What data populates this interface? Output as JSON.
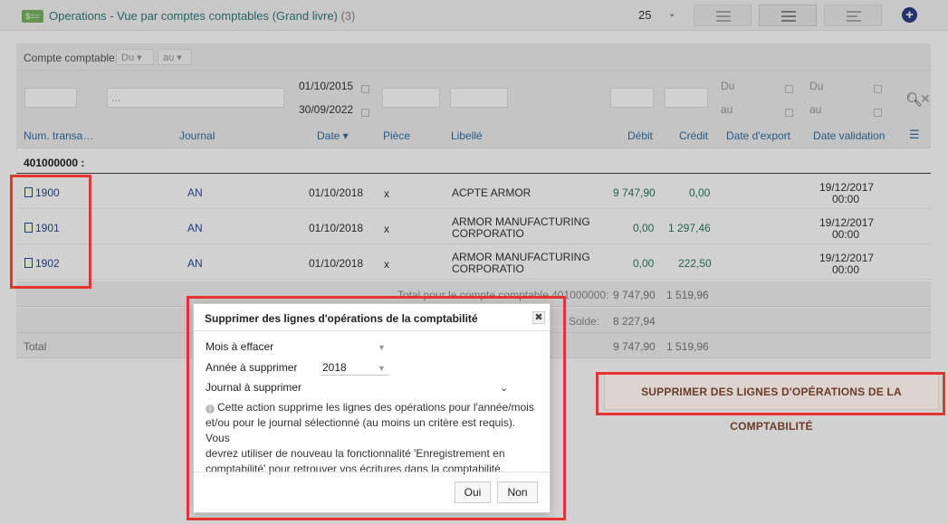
{
  "header": {
    "badge": "$==",
    "title": "Operations - Vue par comptes comptables (Grand livre)",
    "count": "(3)",
    "page_size": "25"
  },
  "filters": {
    "compte_label": "Compte comptable:",
    "du": "Du",
    "au": "au",
    "date_from": "01/10/2015",
    "date_to": "30/09/2022",
    "export_du": "Du",
    "export_au": "au",
    "valid_du": "Du",
    "valid_au": "au",
    "journal_placeholder": "..."
  },
  "columns": {
    "num": "Num. transa…",
    "journal": "Journal",
    "date": "Date ▾",
    "piece": "Pièce",
    "libelle": "Libellé",
    "debit": "Débit",
    "credit": "Crédit",
    "export": "Date d'export",
    "validation": "Date validation"
  },
  "group": {
    "label": "401000000 :"
  },
  "rows": [
    {
      "num": "1900",
      "journal": "AN",
      "date": "01/10/2018",
      "piece": "x",
      "libelle_1": "ACPTE ARMOR",
      "libelle_2": "",
      "debit": "9 747,90",
      "credit": "0,00",
      "validation_date": "19/12/2017",
      "validation_time": "00:00"
    },
    {
      "num": "1901",
      "journal": "AN",
      "date": "01/10/2018",
      "piece": "x",
      "libelle_1": "ARMOR MANUFACTURING",
      "libelle_2": "CORPORATIO",
      "debit": "0,00",
      "credit": "1 297,46",
      "validation_date": "19/12/2017",
      "validation_time": "00:00"
    },
    {
      "num": "1902",
      "journal": "AN",
      "date": "01/10/2018",
      "piece": "x",
      "libelle_1": "ARMOR MANUFACTURING",
      "libelle_2": "CORPORATIO",
      "debit": "0,00",
      "credit": "222,50",
      "validation_date": "19/12/2017",
      "validation_time": "00:00"
    }
  ],
  "totals": {
    "account_label": "Total pour le compte comptable 401000000:",
    "account_debit": "9 747,90",
    "account_credit": "1 519,96",
    "solde_label": "Solde:",
    "solde_value": "8 227,94",
    "total_label": "Total",
    "total_debit": "9 747,90",
    "total_credit": "1 519,96"
  },
  "action_button": "SUPPRIMER DES LIGNES D'OPÉRATIONS DE LA COMPTABILITÉ",
  "modal": {
    "title": "Supprimer des lignes d'opérations de la comptabilité",
    "close": "✖",
    "mois_label": "Mois à effacer",
    "annee_label": "Année à supprimer",
    "annee_value": "2018",
    "journal_label": "Journal à supprimer",
    "note_1": "Cette action supprime les lignes des opérations pour l'année/mois",
    "note_2": "et/ou pour le journal sélectionné (au moins un critère est requis). Vous",
    "note_3": "devrez utiliser de nouveau la fonctionnalité 'Enregistrement en",
    "note_4": "comptabilité' pour retrouver vos écritures dans la comptabilité.",
    "oui": "Oui",
    "non": "Non"
  },
  "colors": {
    "highlight": "#e3342f",
    "title_teal": "#2f7a7a",
    "link_blue": "#2a4a8f",
    "amount_green": "#2d7a5a"
  }
}
